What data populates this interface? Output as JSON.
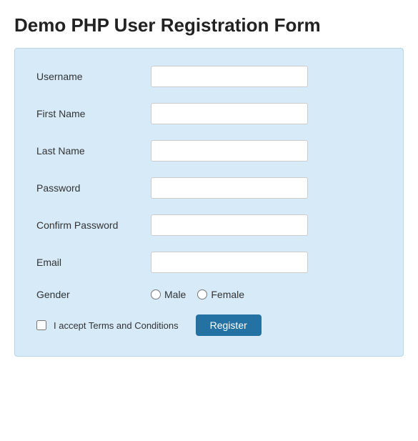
{
  "page": {
    "title": "Demo PHP User Registration Form"
  },
  "form": {
    "fields": [
      {
        "id": "username",
        "label": "Username",
        "type": "text",
        "placeholder": ""
      },
      {
        "id": "first_name",
        "label": "First Name",
        "type": "text",
        "placeholder": ""
      },
      {
        "id": "last_name",
        "label": "Last Name",
        "type": "text",
        "placeholder": ""
      },
      {
        "id": "password",
        "label": "Password",
        "type": "password",
        "placeholder": ""
      },
      {
        "id": "confirm_password",
        "label": "Confirm Password",
        "type": "password",
        "placeholder": ""
      },
      {
        "id": "email",
        "label": "Email",
        "type": "email",
        "placeholder": ""
      }
    ],
    "gender": {
      "label": "Gender",
      "options": [
        "Male",
        "Female"
      ]
    },
    "terms": {
      "label": "I accept Terms and Conditions"
    },
    "submit_label": "Register"
  }
}
